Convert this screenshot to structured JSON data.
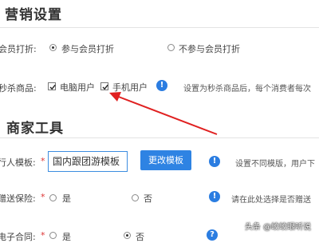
{
  "marketing": {
    "title": "营销设置",
    "member_discount": {
      "label": "会员打折:",
      "options": [
        "参与会员打折",
        "不参与会员打折"
      ],
      "selected": "参与会员打折"
    },
    "flash_sale": {
      "label": "秒杀商品:",
      "options": [
        {
          "label": "电脑用户",
          "checked": true
        },
        {
          "label": "手机用户",
          "checked": true
        }
      ],
      "info_glyph": "!",
      "hint": "设置为秒杀商品后，每个消费者每次"
    }
  },
  "merchant": {
    "title": "商家工具",
    "template": {
      "label": "行人模板:",
      "required_mark": "*",
      "value": "国内跟团游模板",
      "button_label": "更改模板",
      "info_glyph": "!",
      "hint": "设置不同模版，用户下"
    },
    "insurance": {
      "label": "赠送保险:",
      "required_mark": "*",
      "options": [
        "是",
        "否"
      ],
      "info_glyph": "!",
      "hint": "请在此处选择是否赠送"
    },
    "contract": {
      "label": "电子合同:",
      "required_mark": "*",
      "options": [
        "是",
        "否"
      ],
      "selected": "否",
      "info_glyph": "?"
    }
  },
  "watermark": "头条 @皎皎眼听说",
  "colors": {
    "accent_blue": "#2e83e3",
    "info_blue": "#2b7de1",
    "arrow_red": "#e02020",
    "required_red": "#d33"
  }
}
